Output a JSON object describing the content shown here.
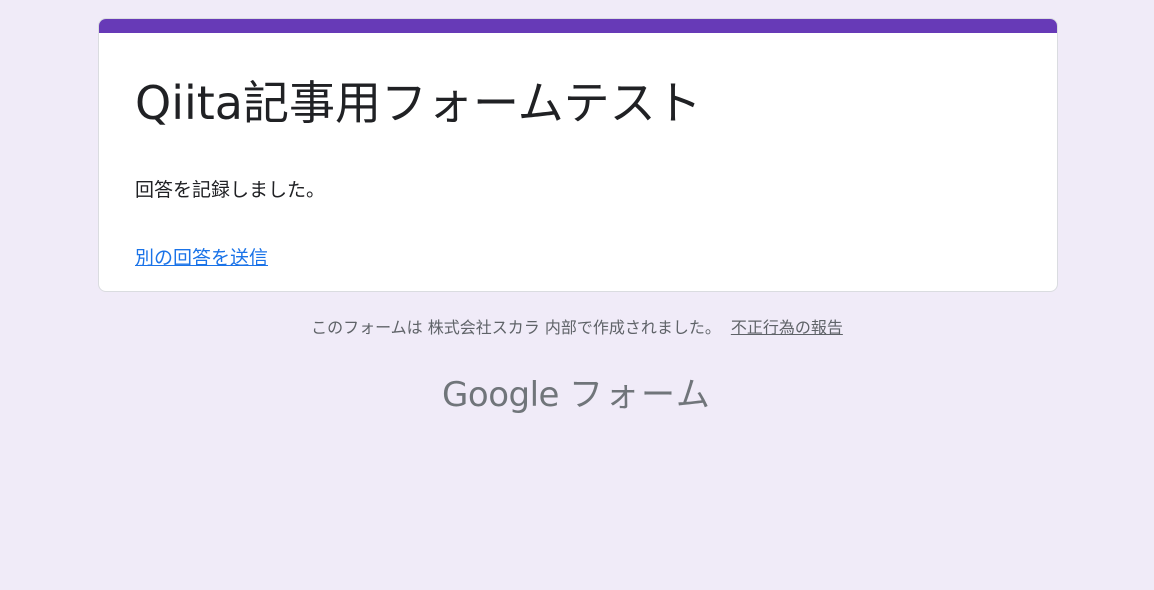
{
  "form": {
    "title": "Qiita記事用フォームテスト",
    "confirmation_message": "回答を記録しました。",
    "submit_another_link": "別の回答を送信",
    "accent_color": "#673ab7"
  },
  "footer": {
    "note": "このフォームは 株式会社スカラ 内部で作成されました。",
    "report_abuse_link": "不正行為の報告",
    "brand_google": "Google",
    "brand_forms": "フォーム"
  },
  "colors": {
    "background": "#f0ebf8",
    "card": "#ffffff",
    "link": "#1a73e8",
    "muted_text": "#5f6368"
  }
}
